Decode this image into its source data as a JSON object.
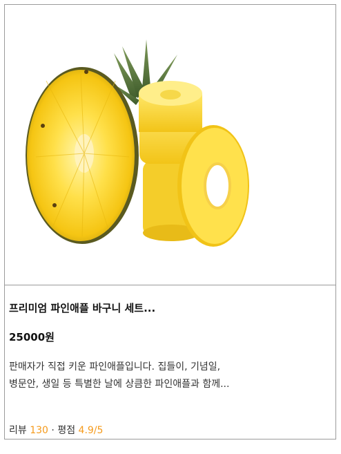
{
  "product": {
    "image_alt": "pineapple-photo",
    "title": "프리미엄 파인애플 바구니 세트...",
    "price": "25000원",
    "description": "판매자가 직접 키운 파인애플입니다. 집들이, 기념일, 병문안, 생일 등 특별한 날에 상큼한 파인애플과 함께...",
    "review_label": "리뷰",
    "review_count": "130",
    "separator": "·",
    "rating_label": "평점",
    "rating_value": "4.9/5"
  },
  "colors": {
    "accent": "#f59a1b",
    "border": "#9a9a9a",
    "text": "#222222"
  }
}
